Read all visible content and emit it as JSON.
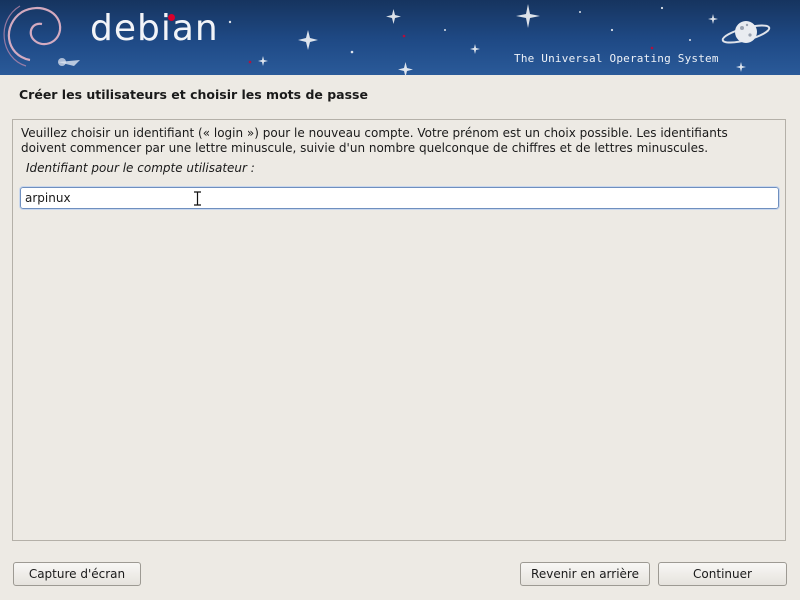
{
  "banner": {
    "logo_text": "debian",
    "tagline": "The Universal Operating System"
  },
  "page": {
    "title": "Créer les utilisateurs et choisir les mots de passe",
    "description_line1": "Veuillez choisir un identifiant (« login ») pour le nouveau compte. Votre prénom est un choix possible. Les identifiants",
    "description_line2": "doivent commencer par une lettre minuscule, suivie d'un nombre quelconque de chiffres et de lettres minuscules.",
    "field_label": "Identifiant pour le compte utilisateur :",
    "username_value": "arpinux"
  },
  "buttons": {
    "screenshot": "Capture d'écran",
    "back": "Revenir en arrière",
    "continue": "Continuer"
  },
  "colors": {
    "banner_bg": "#1f4a86",
    "window_bg": "#edeae4",
    "input_border": "#6f8fbf",
    "logo_dot": "#d8002b"
  },
  "icons": {
    "swirl": "debian-swirl-icon",
    "planet": "planet-icon",
    "cursor": "text-cursor-icon"
  }
}
